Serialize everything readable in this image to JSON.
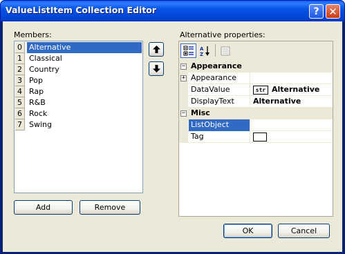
{
  "window": {
    "title": "ValueListItem Collection Editor"
  },
  "titlebar_buttons": {
    "help": "?",
    "close": "✕"
  },
  "members": {
    "label": "Members:",
    "items": [
      {
        "index": "0",
        "name": "Alternative",
        "selected": true
      },
      {
        "index": "1",
        "name": "Classical"
      },
      {
        "index": "2",
        "name": "Country"
      },
      {
        "index": "3",
        "name": "Pop"
      },
      {
        "index": "4",
        "name": "Rap"
      },
      {
        "index": "5",
        "name": "R&B"
      },
      {
        "index": "6",
        "name": "Rock"
      },
      {
        "index": "7",
        "name": "Swing"
      }
    ],
    "add_label": "Add",
    "remove_label": "Remove",
    "move_up_icon": "arrow-up-icon",
    "move_down_icon": "arrow-down-icon"
  },
  "properties": {
    "label": "Alternative properties:",
    "toolbar": {
      "categorized_icon": "categorized-icon",
      "alphabetical_icon": "alphabetical-icon",
      "pages_icon": "property-pages-icon"
    },
    "categories": [
      {
        "name": "Appearance",
        "rows": [
          {
            "name": "Appearance",
            "value": "",
            "expandable": true
          },
          {
            "name": "DataValue",
            "badge": "str",
            "value": "Alternative",
            "bold": true
          },
          {
            "name": "DisplayText",
            "value": "Alternative",
            "bold": true
          }
        ]
      },
      {
        "name": "Misc",
        "rows": [
          {
            "name": "ListObject",
            "value": "",
            "selected": true
          },
          {
            "name": "Tag",
            "value": "",
            "swatch": true
          }
        ]
      }
    ]
  },
  "footer": {
    "ok_label": "OK",
    "cancel_label": "Cancel"
  }
}
